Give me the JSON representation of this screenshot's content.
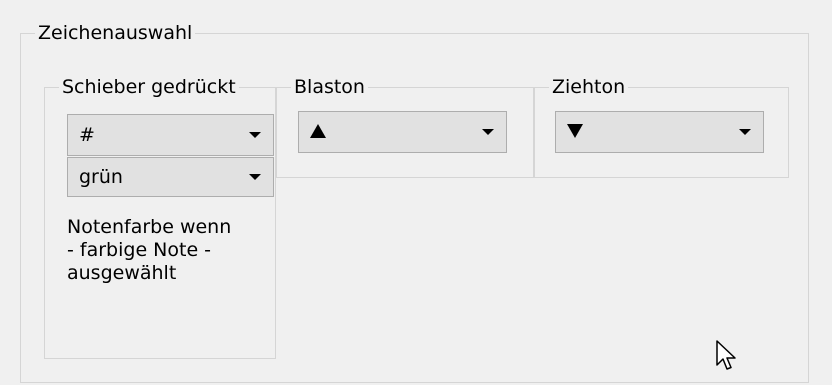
{
  "groups": {
    "outer": {
      "title": "Zeichenauswahl"
    },
    "schieber": {
      "title": "Schieber gedrückt",
      "symbol_value": "#",
      "color_value": "grün",
      "note_lines": [
        "Notenfarbe wenn",
        "- farbige Note -",
        "ausgewählt"
      ]
    },
    "blaston": {
      "title": "Blaston",
      "value_icon": "triangle-up-icon"
    },
    "ziehton": {
      "title": "Ziehton",
      "value_icon": "triangle-down-icon"
    }
  },
  "colors": {
    "background": "#f0f0f0",
    "combo_fill": "#e1e1e1",
    "combo_border": "#adadad",
    "group_border": "#d5d5d5"
  }
}
